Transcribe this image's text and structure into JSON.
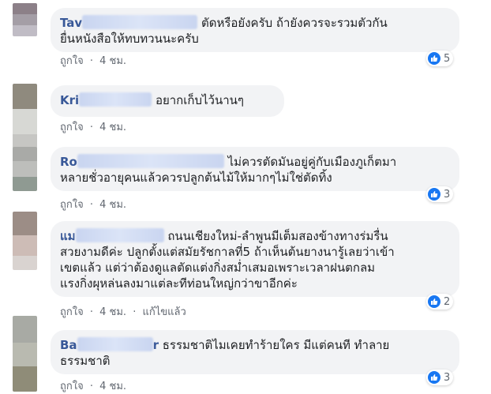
{
  "comments": [
    {
      "name": "Tav",
      "text": "ตัดหรือยังครับ ถ้ายังควรจะรวมตัวกันยื่นหนังสือให้ทบทวนนะครับ",
      "line1": "ตัดหรือยังครับ ถ้ายังควรจะรวมตัวกัน",
      "line2": "ยื่นหนังสือให้ทบทวนนะครับ",
      "like": "ถูกใจ",
      "time": "4 ชม.",
      "reactions": "5",
      "avatar_colors": [
        "#8c8088",
        "#a49ea6",
        "#c0bcc5"
      ]
    },
    {
      "name": "Kri",
      "line1": "อยากเก็บไว้นานๆ",
      "like": "ถูกใจ",
      "time": "4 ชม.",
      "avatar_colors": [
        "#8f8a7e",
        "#d7d8d4",
        "#c6c6c3"
      ]
    },
    {
      "name": "Ro",
      "line1": "ไม่ควรตัดมันอยู่คู่กับเมืองภูเก็ตมา",
      "line2": "หลายชั่วอายุคนแล้วควรปลูกต้นไม้ให้มากๆไม่ใช่ตัดทิ้ง",
      "like": "ถูกใจ",
      "time": "4 ชม.",
      "reactions": "3",
      "avatar_colors": [
        "#a9aaa7",
        "#bdbebb",
        "#8f9a92"
      ]
    },
    {
      "name": "แม",
      "line1": "ถนนเชียงใหม่-ลำพูนมีเต็มสองข้างทางร่มรื่น",
      "line2": "สวยงามดีค่ะ ปลูกตั้งแต่สมัยรัชกาลที่5 ถ้าเห็นต้นยางนารู้เลยว่าเข้า",
      "line3": "เขตแล้ว แต่ว่าต้องดูแลตัดแต่งกิ่งสม่ำเสมอเพราะเวลาฝนตกลม",
      "line4": "แรงกิ่งผุหล่นลงมาแต่ละทีท่อนใหญ่กว่าขาอีกค่ะ",
      "like": "ถูกใจ",
      "time": "4 ชม.",
      "edited": "แก้ไขแล้ว",
      "reactions": "2",
      "avatar_colors": [
        "#9c8d86",
        "#cdbcb6",
        "#d9d3d0"
      ]
    },
    {
      "name": "Ba",
      "name_end": "r",
      "line1": "ธรรมชาติไมเคยทำร้ายใคร มีแต่คนที ทำลาย",
      "line2": "ธรรมชาติ",
      "like": "ถูกใจ",
      "time": "4 ชม.",
      "reactions": "3",
      "avatar_colors": [
        "#a8aaa4",
        "#b9bab0",
        "#8f8c78"
      ]
    }
  ],
  "sep": "·",
  "colors": {
    "link": "#385898",
    "like_blue": "#1877f2",
    "bubble": "#f2f3f5"
  }
}
